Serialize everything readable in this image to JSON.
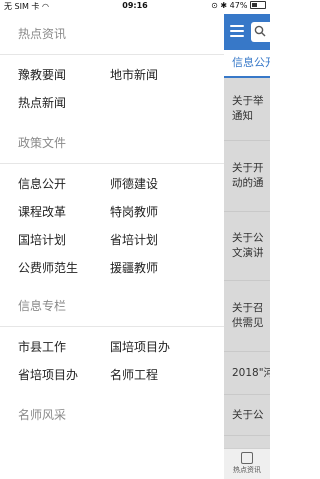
{
  "status_bar": {
    "carrier": "无 SIM 卡",
    "time": "09:16",
    "battery": "47%"
  },
  "drawer": {
    "sections": [
      {
        "title": "热点资讯",
        "items": [
          "豫教要闻",
          "地市新闻",
          "热点新闻"
        ]
      },
      {
        "title": "政策文件",
        "items": [
          "信息公开",
          "师德建设",
          "课程改革",
          "特岗教师",
          "国培计划",
          "省培计划",
          "公费师范生",
          "援疆教师"
        ]
      },
      {
        "title": "信息专栏",
        "items": [
          "市县工作",
          "国培项目办",
          "省培项目办",
          "名师工程"
        ]
      },
      {
        "title": "名师风采",
        "items": []
      }
    ]
  },
  "main": {
    "active_tab": "信息公开",
    "list_items": [
      "关于举\n通知",
      "关于开\n动的通",
      "关于公\n文演讲",
      "关于召\n供需见",
      "2018\"河",
      "关于公"
    ],
    "bottom_tab_label": "热点资讯"
  },
  "colors": {
    "accent": "#3778c8"
  }
}
